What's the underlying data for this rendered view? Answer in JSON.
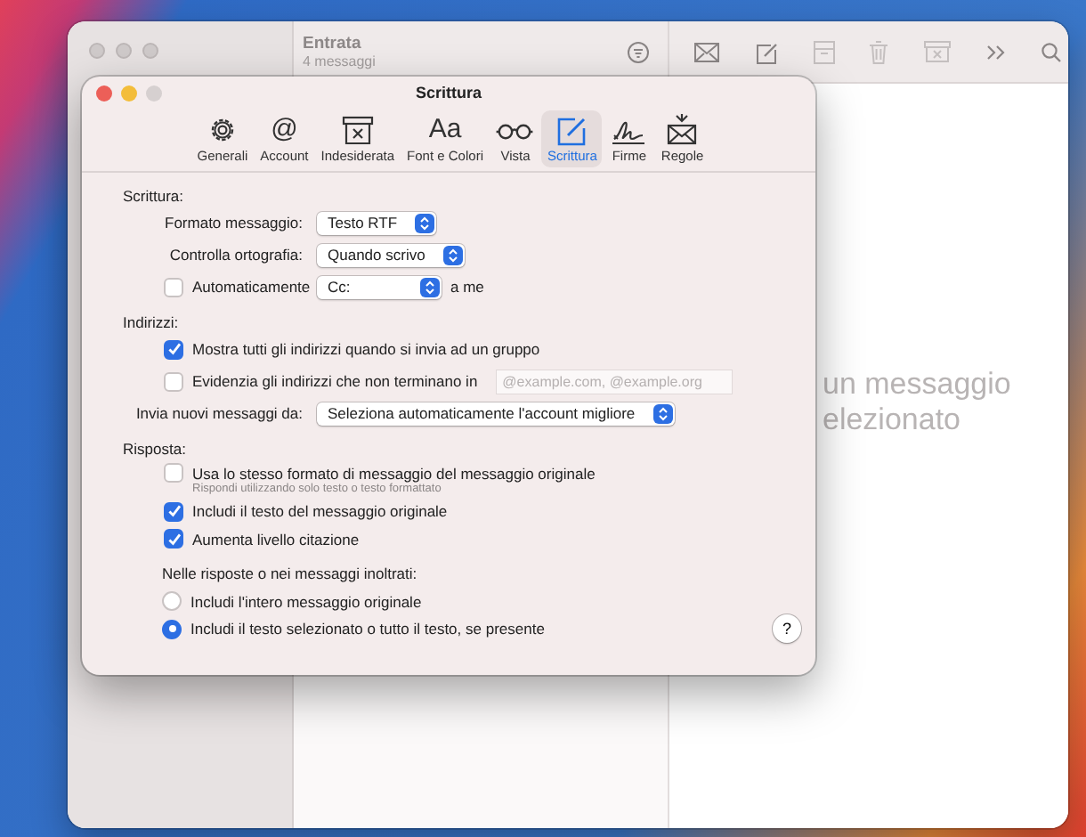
{
  "mail_window": {
    "title": "Entrata",
    "subtitle": "4 messaggi",
    "viewer_message": [
      "un messaggio",
      "elezionato"
    ]
  },
  "preferences": {
    "title": "Scrittura",
    "tabs": [
      {
        "label": "Generali",
        "selected": false
      },
      {
        "label": "Account",
        "selected": false,
        "glyph": "@"
      },
      {
        "label": "Indesiderata",
        "selected": false
      },
      {
        "label": "Font e Colori",
        "selected": false,
        "glyph": "Aa"
      },
      {
        "label": "Vista",
        "selected": false
      },
      {
        "label": "Scrittura",
        "selected": true
      },
      {
        "label": "Firme",
        "selected": false
      },
      {
        "label": "Regole",
        "selected": false
      }
    ],
    "sections": [
      {
        "heading": "Scrittura:",
        "rows": [
          {
            "kind": "popup",
            "label": "Formato messaggio:",
            "value": "Testo RTF"
          },
          {
            "kind": "popup",
            "label": "Controlla ortografia:",
            "value": "Quando scrivo"
          },
          {
            "kind": "check-popup",
            "label": "Automaticamente",
            "checked": false,
            "value": "Cc:",
            "suffix": "a me"
          }
        ]
      },
      {
        "heading": "Indirizzi:",
        "rows": [
          {
            "kind": "checkbox",
            "label": "Mostra tutti gli indirizzi quando si invia ad un gruppo",
            "checked": true
          },
          {
            "kind": "check-field",
            "label": "Evidenzia gli indirizzi che non terminano in",
            "checked": false,
            "placeholder": "@example.com, @example.org"
          },
          {
            "kind": "popup",
            "label": "Invia nuovi messaggi da:",
            "value": "Seleziona automaticamente l'account migliore"
          }
        ]
      },
      {
        "heading": "Risposta:",
        "rows": [
          {
            "kind": "checkbox",
            "label": "Usa lo stesso formato di messaggio del messaggio originale",
            "checked": false,
            "note": "Rispondi utilizzando solo testo o testo formattato"
          },
          {
            "kind": "checkbox",
            "label": "Includi il testo del messaggio originale",
            "checked": true
          },
          {
            "kind": "checkbox",
            "label": "Aumenta livello citazione",
            "checked": true
          },
          {
            "kind": "caption",
            "label": "Nelle risposte o nei messaggi inoltrati:"
          },
          {
            "kind": "radio",
            "label": "Includi l'intero messaggio originale",
            "selected": false
          },
          {
            "kind": "radio",
            "label": "Includi il testo selezionato o tutto il testo, se presente",
            "selected": true
          }
        ]
      }
    ],
    "help_button": "?"
  }
}
